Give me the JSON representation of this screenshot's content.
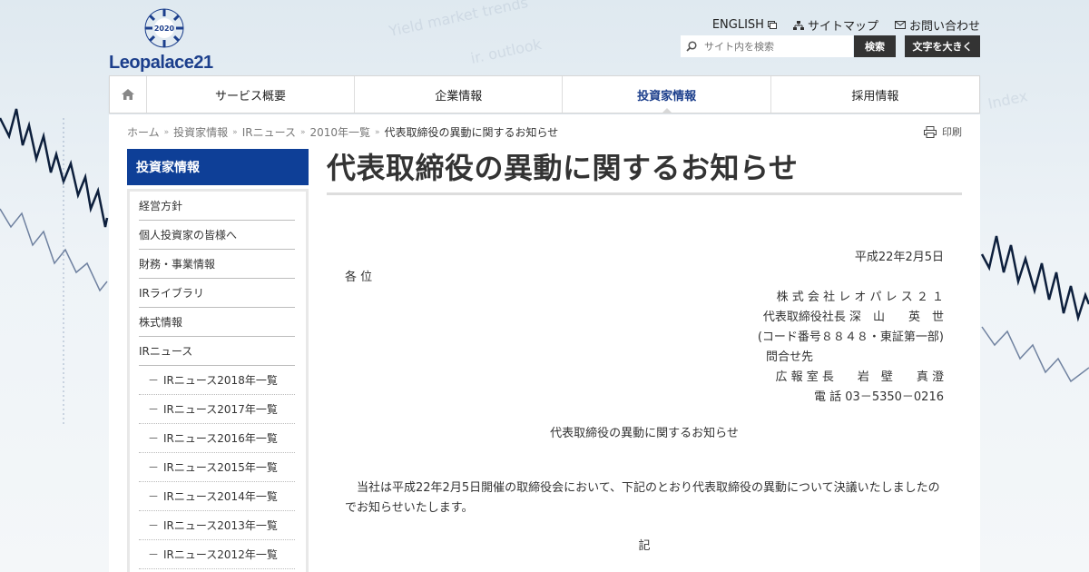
{
  "header": {
    "logo_emblem_text": "CREATIVE EVOLUTION 2020",
    "logo_text": "Leopalace21",
    "util_links": [
      {
        "label": "ENGLISH",
        "icon": "external-window-icon"
      },
      {
        "label": "サイトマップ",
        "icon": "sitemap-icon"
      },
      {
        "label": "お問い合わせ",
        "icon": "mail-icon"
      }
    ],
    "search_placeholder": "サイト内を検索",
    "search_button": "検索",
    "large_text_button": "文字を大きく"
  },
  "gnav": {
    "home_icon": "home-icon",
    "items": [
      "サービス概要",
      "企業情報",
      "投資家情報",
      "採用情報"
    ],
    "active": "投資家情報"
  },
  "breadcrumb": [
    "ホーム",
    "投資家情報",
    "IRニュース",
    "2010年一覧",
    "代表取締役の異動に関するお知らせ"
  ],
  "print_label": "印刷",
  "sidebar": {
    "heading": "投資家情報",
    "items": [
      "経営方針",
      "個人投資家の皆様へ",
      "財務・事業情報",
      "IRライブラリ",
      "株式情報",
      "IRニュース"
    ],
    "subitems": [
      "IRニュース2018年一覧",
      "IRニュース2017年一覧",
      "IRニュース2016年一覧",
      "IRニュース2015年一覧",
      "IRニュース2014年一覧",
      "IRニュース2013年一覧",
      "IRニュース2012年一覧"
    ]
  },
  "main": {
    "title": "代表取締役の異動に関するお知らせ",
    "date": "平成22年2月5日",
    "addressee": "各 位",
    "company": "株 式 会 社 レ オ パ レ ス ２ １",
    "representative": "代表取締役社長 深　山　　英　世",
    "code": "(コード番号８８４８・東証第一部)",
    "contact_label": "問合せ先",
    "contact_person": "広 報 室 長　　岩　壁　　真 澄",
    "phone": "電 話 03－5350－0216",
    "notice_title": "代表取締役の異動に関するお知らせ",
    "body": "当社は平成22年2月5日開催の取締役会において、下記のとおり代表取締役の異動について決議いたしましたのでお知らせいたします。",
    "ki": "記"
  },
  "colors": {
    "brand_blue": "#0e3f97",
    "active_nav": "#1c3f8c",
    "dark_button": "#333333"
  }
}
